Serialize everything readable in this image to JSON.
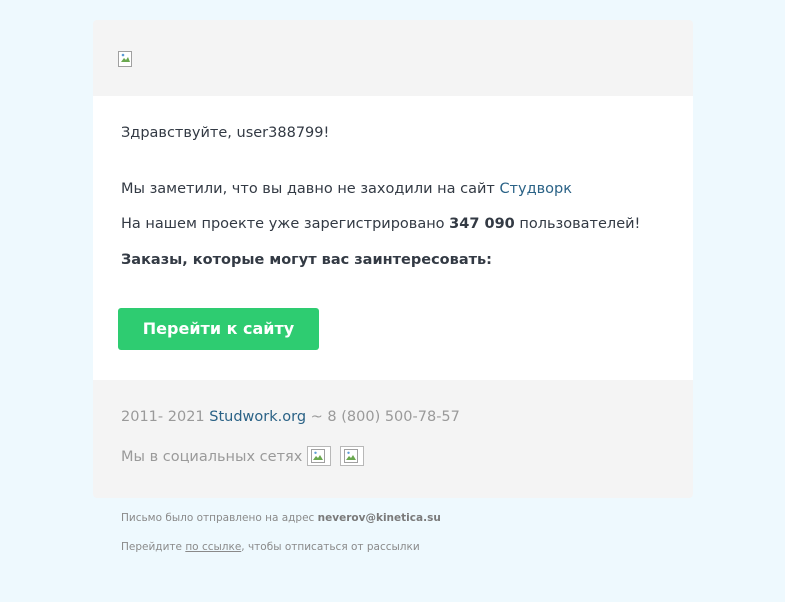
{
  "header": {
    "logo_icon": "broken-image-icon"
  },
  "content": {
    "greeting": "Здравствуйте, user388799!",
    "line1_text": "Мы заметили, что вы давно не заходили на сайт ",
    "line1_link": "Студворк",
    "line2_prefix": "На нашем проекте уже зарегистрировано ",
    "line2_count": "347 090",
    "line2_suffix": " пользователей!",
    "orders_heading": "Заказы, которые могут вас заинтересовать:",
    "button_label": "Перейти к сайту",
    "button_color": "#2ecc71",
    "link_color": "#2a6286"
  },
  "footer": {
    "years": "2011- 2021 ",
    "site_link": "Studwork.org",
    "phone": " ~ 8 (800) 500-78-57",
    "social_label": "Мы в социальных сетях",
    "social_icons": [
      "broken-image-icon",
      "broken-image-icon"
    ]
  },
  "below": {
    "sent_prefix": "Письмо было отправлено на адрес ",
    "email": "neverov@kinetica.su",
    "unsub_prefix": "Перейдите ",
    "unsub_link": "по ссылке",
    "unsub_suffix": ", чтобы отписаться от рассылки"
  }
}
